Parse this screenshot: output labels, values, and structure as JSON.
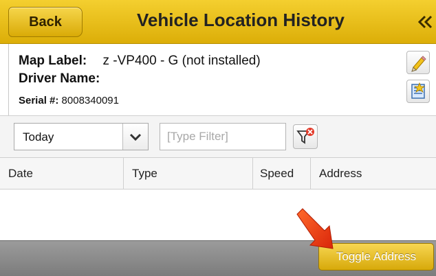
{
  "header": {
    "back_label": "Back",
    "title": "Vehicle Location History",
    "collapse_glyph": "«",
    "color": "#e8bf16"
  },
  "info": {
    "map_label_key": "Map Label:",
    "map_label_value": "z -VP400 - G (not installed)",
    "driver_name_key": "Driver Name:",
    "driver_name_value": "",
    "serial_key": "Serial #:",
    "serial_value": "8008340091",
    "edit_icon": "pencil-icon",
    "doc_icon": "document-icon"
  },
  "filters": {
    "date_range": "Today",
    "type_filter_placeholder": "[Type Filter]",
    "clear_filter_icon": "filter-clear-icon"
  },
  "table": {
    "columns": [
      "Date",
      "Type",
      "Speed",
      "Address"
    ],
    "rows": []
  },
  "footer": {
    "toggle_label": "Toggle Address",
    "annotation_color": "#ee3a12"
  }
}
